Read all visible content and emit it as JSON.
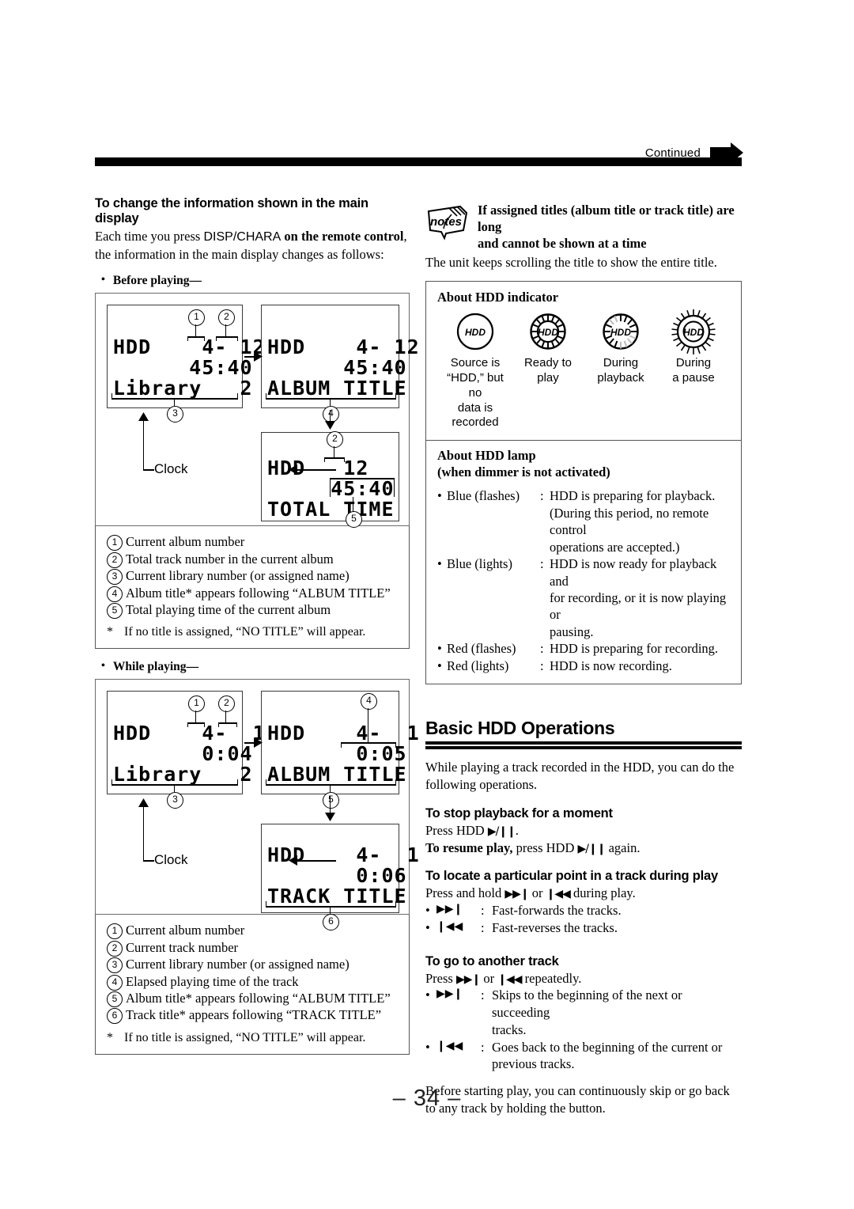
{
  "header": {
    "continued_label": "Continued",
    "continued_arrow_icon": "right-arrow-icon"
  },
  "page_number": "– 34 –",
  "left_column": {
    "heading": "To change the information shown in the main display",
    "intro_1a": "Each time you press ",
    "intro_1b": "DISP/CHARA",
    "intro_1c": " on the remote control",
    "intro_1d": ",",
    "intro_2": "the information in the main display changes as follows:",
    "before_playing_label": "Before playing—",
    "while_playing_label": "While playing—",
    "clock_label": "Clock",
    "before_playing_displays": [
      {
        "line1": "HDD    4- 12",
        "line2": "      45:40",
        "line3": "Library   2"
      },
      {
        "line1": "HDD    4- 12",
        "line2": "      45:40",
        "line3": "ALBUM TITLE"
      },
      {
        "line1": "HDD   12",
        "line2": "     45:40",
        "line3": "TOTAL TIME"
      }
    ],
    "while_playing_displays": [
      {
        "line1": "HDD    4-  1",
        "line2": "       0:04",
        "line3": "Library   2"
      },
      {
        "line1": "HDD    4-  1",
        "line2": "       0:05",
        "line3": "ALBUM TITLE"
      },
      {
        "line1": "HDD    4-  1",
        "line2": "       0:06",
        "line3": "TRACK TITLE"
      }
    ],
    "before_playing_legend": [
      {
        "num": "1",
        "text": "Current album number"
      },
      {
        "num": "2",
        "text": "Total track number in the current album"
      },
      {
        "num": "3",
        "text": "Current library number (or assigned name)"
      },
      {
        "num": "4",
        "text": "Album title* appears following “ALBUM TITLE”"
      },
      {
        "num": "5",
        "text": "Total playing time of the current album"
      }
    ],
    "before_playing_footnote_star": "*",
    "before_playing_footnote": "If no title is assigned, “NO TITLE” will appear.",
    "while_playing_legend": [
      {
        "num": "1",
        "text": "Current album number"
      },
      {
        "num": "2",
        "text": "Current track number"
      },
      {
        "num": "3",
        "text": "Current library number (or assigned name)"
      },
      {
        "num": "4",
        "text": "Elapsed playing time of the track"
      },
      {
        "num": "5",
        "text": "Album title* appears following “ALBUM TITLE”"
      },
      {
        "num": "6",
        "text": "Track title* appears following “TRACK TITLE”"
      }
    ],
    "while_playing_footnote_star": "*",
    "while_playing_footnote": "If no title is assigned, “NO TITLE” will appear."
  },
  "right_column": {
    "notes": {
      "icon_label": "notes",
      "heading_line1": "If assigned titles (album title or track title) are long",
      "heading_line2": "and cannot be shown at a time",
      "body": "The unit keeps scrolling the title to show the entire title."
    },
    "indicator_box": {
      "title": "About HDD indicator",
      "items": [
        {
          "icon": "hdd-indicator-idle-icon",
          "caption": "Source is\n“HDD,” but no\ndata is recorded"
        },
        {
          "icon": "hdd-indicator-ready-icon",
          "caption": "Ready to\nplay"
        },
        {
          "icon": "hdd-indicator-playback-icon",
          "caption": "During\nplayback"
        },
        {
          "icon": "hdd-indicator-pause-icon",
          "caption": "During\na pause"
        }
      ]
    },
    "lamp_box": {
      "title_line1": "About HDD lamp",
      "title_line2": "(when dimmer is not activated)",
      "rows": [
        {
          "color": "Blue (flashes)",
          "colon": ":",
          "desc": "HDD is preparing for playback.",
          "cont": [
            "(During this period, no remote control",
            "operations are accepted.)"
          ]
        },
        {
          "color": "Blue (lights)",
          "colon": ":",
          "desc": "HDD is now ready for playback and",
          "cont": [
            "for recording, or it is now playing or",
            "pausing."
          ]
        },
        {
          "color": "Red (flashes)",
          "colon": ":",
          "desc": "HDD is preparing for recording.",
          "cont": []
        },
        {
          "color": "Red (lights)",
          "colon": ":",
          "desc": "HDD is now recording.",
          "cont": []
        }
      ]
    },
    "section": {
      "title": "Basic HDD Operations",
      "intro": "While playing a track recorded in the HDD, you can do the following operations.",
      "sub1": {
        "heading": "To stop playback for a moment",
        "line1_a": "Press HDD ",
        "line1_glyph": "▶/❙❙",
        "line1_b": ".",
        "line2_bold": "To resume play,",
        "line2_a": " press HDD ",
        "line2_glyph": "▶/❙❙",
        "line2_b": " again."
      },
      "sub2": {
        "heading": "To locate a particular point in a track during play",
        "intro_a": "Press and hold ",
        "glyph_ff": "▶▶❙",
        "intro_b": " or ",
        "glyph_rw": "❙◀◀",
        "intro_c": " during play.",
        "bullets": [
          {
            "glyph": "▶▶❙",
            "colon": ":",
            "text": "Fast-forwards the tracks."
          },
          {
            "glyph": "❙◀◀",
            "colon": ":",
            "text": "Fast-reverses the tracks."
          }
        ]
      },
      "sub3": {
        "heading": "To go to another track",
        "intro_a": "Press ",
        "glyph_ff": "▶▶❙",
        "intro_b": " or ",
        "glyph_rw": "❙◀◀",
        "intro_c": " repeatedly.",
        "bullets": [
          {
            "glyph": "▶▶❙",
            "colon": ":",
            "text": "Skips to the beginning of the next or succeeding",
            "cont": "tracks."
          },
          {
            "glyph": "❙◀◀",
            "colon": ":",
            "text": "Goes back to the beginning of the current or",
            "cont": "previous tracks."
          }
        ],
        "outro": "Before starting play, you can continuously skip or go back to any track by holding the button."
      }
    }
  }
}
